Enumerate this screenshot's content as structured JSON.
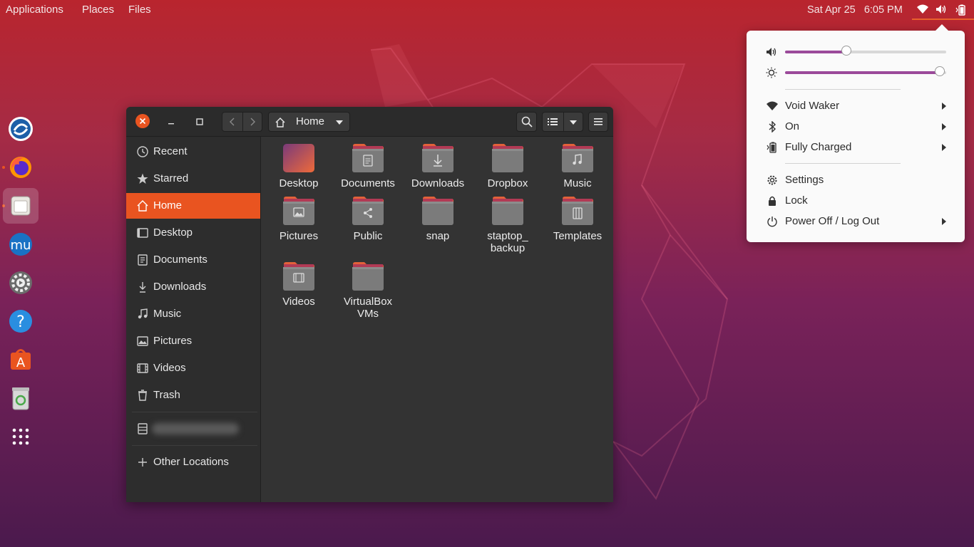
{
  "topbar": {
    "menus": [
      "Applications",
      "Places",
      "Files"
    ],
    "clock_day": "Sat Apr 25",
    "clock_time": "6:05 PM",
    "tray_icons": [
      "wifi-icon",
      "volume-icon",
      "battery-icon"
    ]
  },
  "dock": {
    "apps": [
      {
        "name": "dolphin-emu-icon",
        "running": false
      },
      {
        "name": "firefox-icon",
        "running": true
      },
      {
        "name": "files-icon",
        "running": true,
        "active": true
      },
      {
        "name": "musescore-icon",
        "running": false
      },
      {
        "name": "settings-icon",
        "running": false
      },
      {
        "name": "help-icon",
        "running": false
      },
      {
        "name": "software-center-icon",
        "running": false
      },
      {
        "name": "trash-icon",
        "running": false
      },
      {
        "name": "app-grid-icon",
        "running": false
      }
    ]
  },
  "window": {
    "location": "Home",
    "sidebar": [
      {
        "label": "Recent",
        "icon": "clock-icon"
      },
      {
        "label": "Starred",
        "icon": "star-icon"
      },
      {
        "label": "Home",
        "icon": "home-icon",
        "active": true
      },
      {
        "label": "Desktop",
        "icon": "desktop-icon"
      },
      {
        "label": "Documents",
        "icon": "document-icon"
      },
      {
        "label": "Downloads",
        "icon": "download-icon"
      },
      {
        "label": "Music",
        "icon": "music-icon"
      },
      {
        "label": "Pictures",
        "icon": "picture-icon"
      },
      {
        "label": "Videos",
        "icon": "video-icon"
      },
      {
        "label": "Trash",
        "icon": "trash-icon"
      }
    ],
    "other_locations": "Other Locations",
    "folders": [
      {
        "name": "Desktop",
        "icon": "desktop-folder"
      },
      {
        "name": "Documents",
        "icon": "documents-folder"
      },
      {
        "name": "Downloads",
        "icon": "downloads-folder"
      },
      {
        "name": "Dropbox",
        "icon": "folder"
      },
      {
        "name": "Music",
        "icon": "music-folder"
      },
      {
        "name": "Pictures",
        "icon": "pictures-folder"
      },
      {
        "name": "Public",
        "icon": "public-folder"
      },
      {
        "name": "snap",
        "icon": "folder"
      },
      {
        "name": "staptop_ backup",
        "icon": "folder"
      },
      {
        "name": "Templates",
        "icon": "templates-folder"
      },
      {
        "name": "Videos",
        "icon": "videos-folder"
      },
      {
        "name": "VirtualBox VMs",
        "icon": "folder"
      }
    ]
  },
  "system_menu": {
    "volume_level": 0.38,
    "brightness_level": 0.96,
    "items": [
      {
        "label": "Void Waker",
        "icon": "wifi-icon",
        "submenu": true
      },
      {
        "label": "On",
        "icon": "bluetooth-icon",
        "submenu": true
      },
      {
        "label": "Fully Charged",
        "icon": "battery-icon",
        "submenu": true
      },
      {
        "label": "Settings",
        "icon": "gear-icon",
        "submenu": false
      },
      {
        "label": "Lock",
        "icon": "lock-icon",
        "submenu": false
      },
      {
        "label": "Power Off / Log Out",
        "icon": "power-icon",
        "submenu": true
      }
    ]
  },
  "colors": {
    "accent": "#e95420",
    "slider": "#9b4a9a"
  }
}
